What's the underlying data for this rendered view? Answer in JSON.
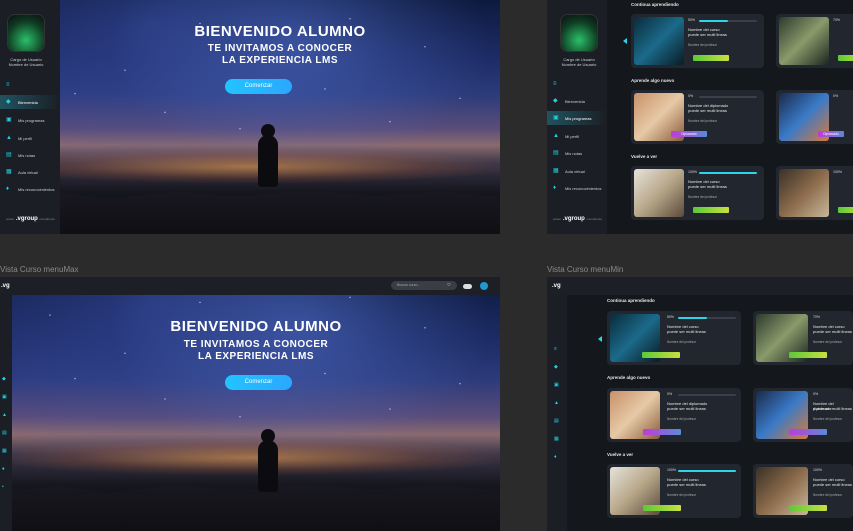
{
  "hero": {
    "title": "BIENVENIDO ALUMNO",
    "subtitle_1": "TE INVITAMOS A CONOCER",
    "subtitle_2": "LA EXPERIENCIA LMS",
    "button": "Comenzar"
  },
  "user": {
    "role": "Cargo de Usuario",
    "name": "Nombre de Usuario"
  },
  "sidebar": {
    "items": [
      {
        "label": "Bienvenida",
        "icon": "home-icon"
      },
      {
        "label": "Mis programas",
        "icon": "book-icon"
      },
      {
        "label": "Mi perfil",
        "icon": "user-icon"
      },
      {
        "label": "Mis notas",
        "icon": "notes-icon"
      },
      {
        "label": "Aula virtual",
        "icon": "class-icon"
      },
      {
        "label": "Mis reconocimientos",
        "icon": "trophy-icon"
      }
    ],
    "brand": ".vgroup",
    "brand_prefix": "power",
    "brand_suffix": "consultores"
  },
  "captions": {
    "bottom_left": "Vista Curso menuMax",
    "bottom_right": "Vista Curso menuMin"
  },
  "topbar": {
    "search_placeholder": "Buscar curso...",
    "logo": ".vg"
  },
  "sections": {
    "continue": "Continua aprendiendo",
    "learn": "Aprende algo nuevo",
    "watch": "Vuelve a ver"
  },
  "cards": {
    "continue": {
      "pct": "50%",
      "pct2": "70%",
      "name_1": "Nombre del curso",
      "name_2": "puede ser multi lineas",
      "prof": "Nombre del profesor",
      "chip": "Continuar"
    },
    "learn": {
      "pct": "0%",
      "pct2": "0%",
      "name_1": "Nombre del diplomado",
      "name_2": "puede ser multi lineas",
      "prof": "Nombre del profesor",
      "chip": "Diplomado",
      "chip2": "Diplomado"
    },
    "watch": {
      "pct": "100%",
      "pct2": "100%",
      "name_1": "Nombre del curso",
      "name_2": "puede ser multi lineas",
      "prof": "Nombre del profesor",
      "chip": "Finalizado"
    }
  },
  "colors": {
    "accent": "#2fd4e8",
    "chip_green": "#8bd43a",
    "chip_purple": "#b04ad8",
    "button": "#22c4ff"
  }
}
